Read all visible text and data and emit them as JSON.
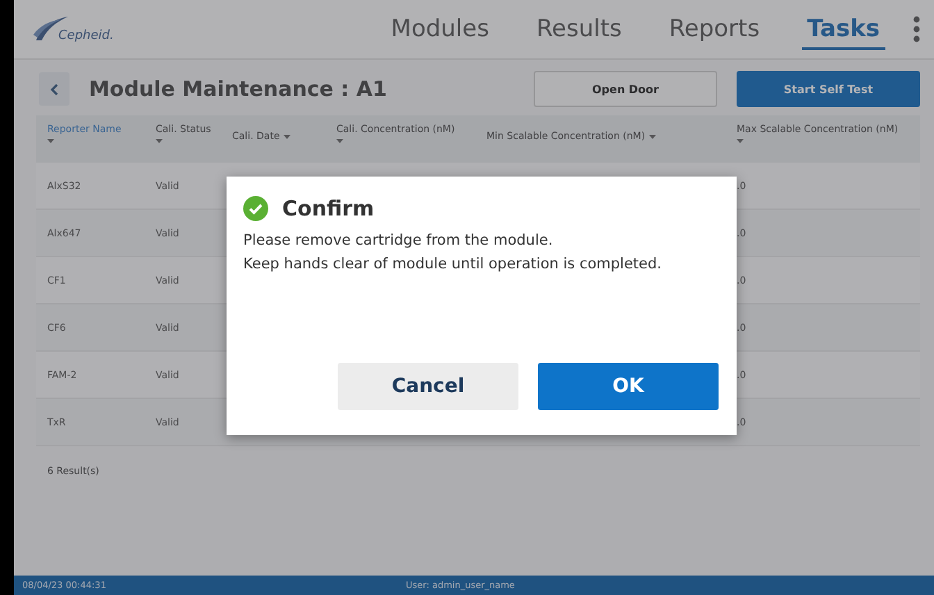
{
  "header": {
    "logo": "Cepheid.",
    "tabs": [
      {
        "label": "Modules",
        "selected": false
      },
      {
        "label": "Results",
        "selected": false
      },
      {
        "label": "Reports",
        "selected": false
      },
      {
        "label": "Tasks",
        "selected": true
      }
    ]
  },
  "toolbar": {
    "title": "Module Maintenance : A1",
    "buttons": [
      {
        "label": "Open Door",
        "kind": "secondary"
      },
      {
        "label": "Start Self Test",
        "kind": "primary"
      }
    ]
  },
  "table": {
    "columns": [
      {
        "label": "Reporter Name",
        "sorted": true,
        "caret_below": true
      },
      {
        "label": "Cali. Status",
        "sorted": false,
        "caret_below": true
      },
      {
        "label": "Cali. Date",
        "sorted": false,
        "caret_below": false
      },
      {
        "label": "Cali. Concentration (nM)",
        "sorted": false,
        "caret_below": true
      },
      {
        "label": "Min Scalable Concentration (nM)",
        "sorted": false,
        "caret_below": false
      },
      {
        "label": "Max Scalable Concentration (nM)",
        "sorted": false,
        "caret_below": true
      }
    ],
    "rows": [
      {
        "reporter": "AlxS32",
        "status": "Valid",
        "max": ".0"
      },
      {
        "reporter": "Alx647",
        "status": "Valid",
        "max": ".0"
      },
      {
        "reporter": "CF1",
        "status": "Valid",
        "max": ".0"
      },
      {
        "reporter": "CF6",
        "status": "Valid",
        "max": ".0"
      },
      {
        "reporter": "FAM-2",
        "status": "Valid",
        "max": ".0"
      },
      {
        "reporter": "TxR",
        "status": "Valid",
        "max": ".0"
      }
    ],
    "count": "6 Result(s)"
  },
  "dialog": {
    "title": "Confirm",
    "lines": [
      "Please remove cartridge from the module.",
      "Keep hands clear of module until operation is completed."
    ],
    "buttons": [
      {
        "label": "Cancel",
        "kind": "secondary"
      },
      {
        "label": "OK",
        "kind": "primary"
      }
    ]
  },
  "status_bar": {
    "datetime": "08/04/23 00:44:31",
    "user": "User: admin_user_name"
  }
}
